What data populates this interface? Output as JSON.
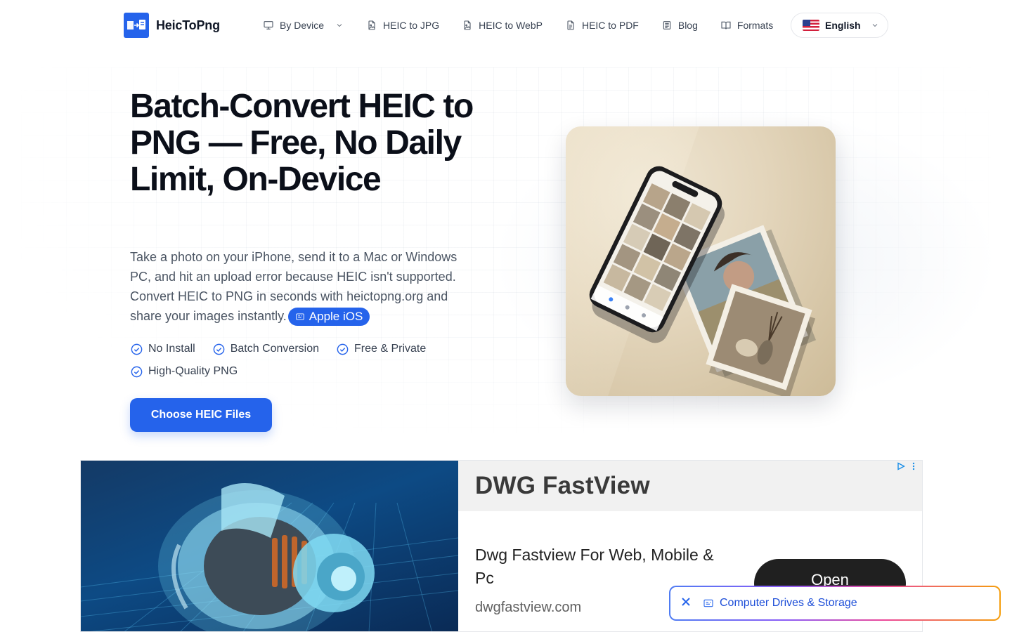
{
  "nav": {
    "brand": "HeicToPng",
    "items": [
      {
        "label": "By Device",
        "icon": "monitor-icon",
        "has_dropdown": true
      },
      {
        "label": "HEIC to JPG",
        "icon": "file-image-icon"
      },
      {
        "label": "HEIC to WebP",
        "icon": "file-image-icon"
      },
      {
        "label": "HEIC to PDF",
        "icon": "file-text-icon"
      },
      {
        "label": "Blog",
        "icon": "newspaper-icon"
      },
      {
        "label": "Formats",
        "icon": "book-open-icon"
      }
    ],
    "language": {
      "label": "English",
      "flag": "us-flag"
    }
  },
  "hero": {
    "title": "Batch-Convert HEIC to PNG — Free, No Daily Limit, On-Device",
    "description": "Take a photo on your iPhone, send it to a Mac or Windows PC, and hit an upload error because HEIC isn't supported. Convert HEIC to PNG in seconds with heictopng.org and share your images instantly.",
    "chip": "Apple iOS",
    "features": [
      "No Install",
      "Batch Conversion",
      "Free & Private",
      "High-Quality PNG"
    ],
    "cta": "Choose HEIC Files"
  },
  "ad": {
    "title": "DWG FastView",
    "description": "Dwg Fastview For Web, Mobile & Pc",
    "url": "dwgfastview.com",
    "button": "Open"
  },
  "floating": {
    "label": "Computer Drives & Storage"
  },
  "colors": {
    "accent": "#2563eb",
    "text_dark": "#0b0f19",
    "text_body": "#4b5563"
  }
}
